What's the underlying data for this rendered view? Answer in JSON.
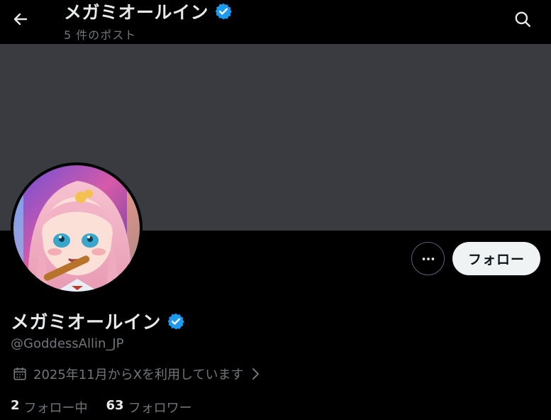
{
  "header": {
    "title": "メガミオールイン",
    "post_count": "5 件のポスト"
  },
  "profile": {
    "display_name": "メガミオールイン",
    "handle": "@GoddessAllin_JP",
    "joined": "2025年11月からXを利用しています",
    "follow_label": "フォロー",
    "following_count": "2",
    "following_label": "フォロー中",
    "followers_count": "63",
    "followers_label": "フォロワー"
  },
  "colors": {
    "background": "#000000",
    "banner": "#3a3b40",
    "verified": "#1d9bf0",
    "secondary_text": "#71767b"
  },
  "icons": {
    "back": "arrow-left-icon",
    "search": "search-icon",
    "more": "more-dots-icon",
    "calendar": "calendar-icon",
    "verified": "verified-badge-icon"
  }
}
